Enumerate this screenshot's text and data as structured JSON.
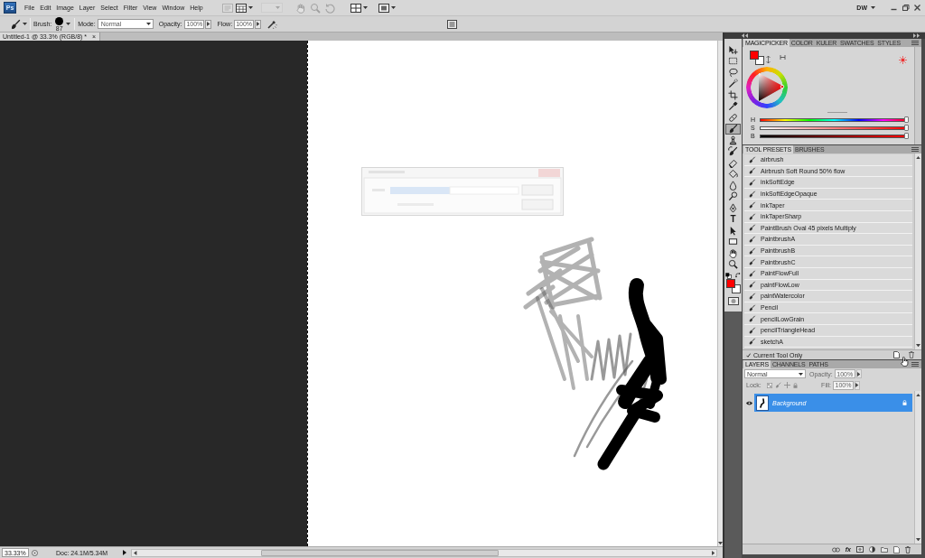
{
  "menu_bar": {
    "logo": "Ps",
    "items": [
      "File",
      "Edit",
      "Image",
      "Layer",
      "Select",
      "Filter",
      "View",
      "Window",
      "Help"
    ],
    "app_buttons": [
      {
        "kind": "bridge",
        "disabled": true
      },
      {
        "kind": "extras",
        "disabled": false
      },
      {
        "kind": "zoom-level",
        "disabled": true
      },
      {
        "kind": "hand",
        "disabled": true
      },
      {
        "kind": "zoom",
        "disabled": true
      },
      {
        "kind": "rotate",
        "disabled": true
      },
      {
        "kind": "arrange",
        "disabled": false
      },
      {
        "kind": "screen-mode",
        "disabled": false
      }
    ],
    "workspace": "DW"
  },
  "options_bar": {
    "brush_label": "Brush:",
    "brush_size": "87",
    "mode_label": "Mode:",
    "mode": "Normal",
    "opacity_label": "Opacity:",
    "opacity": "100%",
    "flow_label": "Flow:",
    "flow": "100%"
  },
  "document": {
    "tabs": [
      {
        "title": "Untitled-1 @ 33.3% (RGB/8) *",
        "close": "×",
        "selected": true
      }
    ]
  },
  "status_bar": {
    "zoom": "33.33%",
    "info": "Doc: 24.1M/5.34M"
  },
  "toolbox": {
    "tools": [
      {
        "kind": "move",
        "selected": false
      },
      {
        "kind": "marquee",
        "selected": false
      },
      {
        "kind": "lasso",
        "selected": false
      },
      {
        "kind": "quick-selection",
        "selected": false
      },
      {
        "kind": "crop",
        "selected": false
      },
      {
        "kind": "eyedropper",
        "selected": false
      },
      {
        "kind": "healing",
        "selected": false
      },
      {
        "kind": "brush",
        "selected": true
      },
      {
        "kind": "clone-stamp",
        "selected": false
      },
      {
        "kind": "history-brush",
        "selected": false
      },
      {
        "kind": "eraser",
        "selected": false
      },
      {
        "kind": "paint-bucket",
        "selected": false
      },
      {
        "kind": "blur",
        "selected": false
      },
      {
        "kind": "dodge",
        "selected": false
      },
      {
        "kind": "pen",
        "selected": false
      },
      {
        "kind": "type",
        "glyph": "T",
        "selected": false
      },
      {
        "kind": "path-selection",
        "selected": false
      },
      {
        "kind": "rectangle",
        "selected": false
      },
      {
        "kind": "hand",
        "selected": false
      },
      {
        "kind": "zoom",
        "selected": false
      }
    ],
    "swatches": [
      {
        "kind": "foreground",
        "color": "#ff0000"
      },
      {
        "kind": "background",
        "color": "#ffffff"
      }
    ]
  },
  "color_panel": {
    "tabs": [
      {
        "label": "MAGICPICKER",
        "selected": true
      },
      {
        "label": "COLOR",
        "selected": false
      },
      {
        "label": "KULER",
        "selected": false
      },
      {
        "label": "SWATCHES",
        "selected": false
      },
      {
        "label": "STYLES",
        "selected": false
      }
    ],
    "swatches": [
      {
        "kind": "foreground",
        "color": "#ff0000"
      },
      {
        "kind": "background",
        "color": "#ffffff"
      }
    ],
    "sliders": [
      {
        "kind": "hue",
        "label": "H",
        "level": 1
      },
      {
        "kind": "saturation",
        "label": "S",
        "level": 1
      },
      {
        "kind": "brightness",
        "label": "B",
        "level": 1
      }
    ]
  },
  "tool_presets": {
    "tabs": [
      {
        "label": "TOOL PRESETS",
        "selected": true
      },
      {
        "label": "BRUSHES",
        "selected": false
      }
    ],
    "items": [
      {
        "label": "airbrush",
        "selected": false
      },
      {
        "label": "Airbrush Soft Round 50% flow",
        "selected": false
      },
      {
        "label": "inkSoftEdge",
        "selected": false
      },
      {
        "label": "inkSoftEdgeOpaque",
        "selected": false
      },
      {
        "label": "inkTaper",
        "selected": false
      },
      {
        "label": "inkTaperSharp",
        "selected": false
      },
      {
        "label": "PaintBrush Oval 45 pixels Multiply",
        "selected": false
      },
      {
        "label": "PaintbrushA",
        "selected": false
      },
      {
        "label": "PaintbrushB",
        "selected": false
      },
      {
        "label": "PaintbrushC",
        "selected": false
      },
      {
        "label": "PaintFlowFull",
        "selected": false
      },
      {
        "label": "paintFlowLow",
        "selected": false
      },
      {
        "label": "paintWatercolor",
        "selected": false
      },
      {
        "label": "Pencil",
        "selected": false
      },
      {
        "label": "pencilLowGrain",
        "selected": false
      },
      {
        "label": "pencilTriangleHead",
        "selected": false
      },
      {
        "label": "sketchA",
        "selected": false
      }
    ],
    "current_tool_only": {
      "label": "Current Tool Only",
      "checked": true
    }
  },
  "layers": {
    "tabs": [
      {
        "label": "LAYERS",
        "selected": true
      },
      {
        "label": "CHANNELS",
        "selected": false
      },
      {
        "label": "PATHS",
        "selected": false
      }
    ],
    "blend_mode": "Normal",
    "opacity": {
      "label": "Opacity:",
      "value": "100%",
      "disabled": true
    },
    "lock": {
      "label": "Lock:",
      "disabled": true
    },
    "fill": {
      "label": "Fill:",
      "value": "100%",
      "disabled": true
    },
    "items": [
      {
        "name": "Background",
        "selected": true,
        "visible": true,
        "locked": true
      }
    ],
    "style_button": "fx"
  }
}
